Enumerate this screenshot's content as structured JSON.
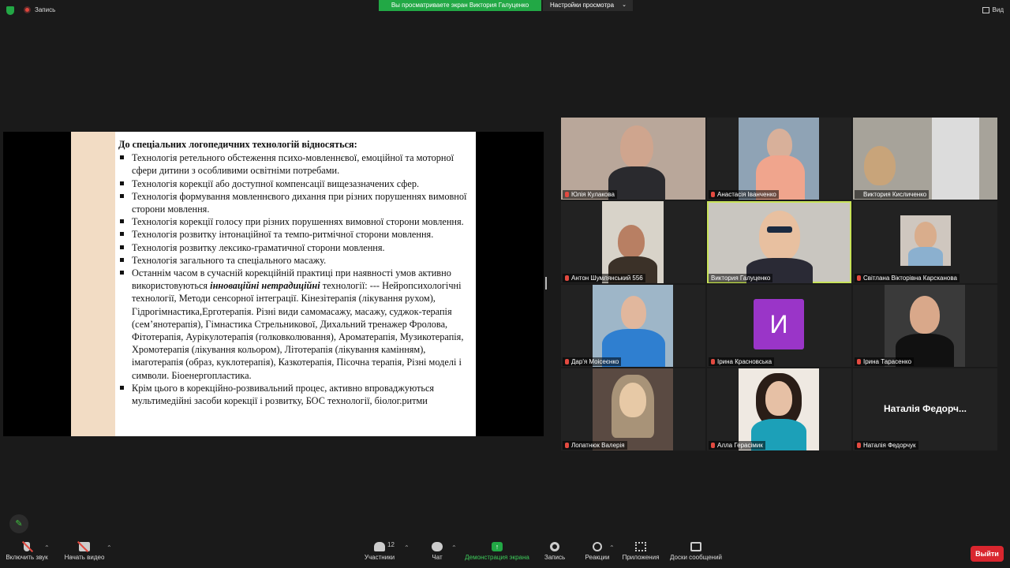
{
  "topbar": {
    "record_label": "Запись",
    "sharing_banner": "Вы просматриваете экран Виктория Галуценко",
    "view_options_label": "Настройки просмотра",
    "view_label": "Вид"
  },
  "slide": {
    "title": "До спеціальних логопедичних  технологій відносяться:",
    "items": [
      "Технологія ретельного обстеження психо-мовленнєвої, емоційної та моторної сфери дитини з особливими освітніми потребами.",
      "Технологія корекції або доступної компенсації вищезазначених сфер.",
      "Технологія формування мовленнєвого дихання при різних порушеннях вимовної сторони мовлення.",
      "Технологія корекції голосу при різних порушеннях  вимовної сторони мовлення.",
      "Технологія розвитку інтонаційної та темпо-ритмічної сторони мовлення.",
      "Технологія розвитку лексико-граматичної сторони мовлення.",
      "Технологія загального та спеціального масажу."
    ],
    "item8_before": "Останнім часом в сучасній корекційній практиці при наявності умов активно використовуються ",
    "item8_em": "інноваційні нетрадиційні",
    "item8_after": "  технології: --- Нейропсихологічні  технології, Методи сенсорної інтеграції. Кінезітерапія (лікування рухом), Гідрогімнастика,Ерготерапія. Різні види самомасажу, масажу, суджок-терапія (сем’янотерапія), Гімнастика Стрельникової, Дихальний тренажер Фролова, Фітотерапія, Аурікулотерапія (голковколювання), Ароматерапія, Музикотерапія, Хромотерапія (лікування кольором), Літотерапія (лікування камінням), імаготерапія (образ, куклотерапія), Казкотерапія, Пісочна терапія, Різні моделі і символи. Біоенергопластика.",
    "item9": "Крім цього в корекційно-розвивальний процес, активно впроваджуються мультимедійні засоби корекції і розвитку, БОС технології, біолог.ритми"
  },
  "participants": [
    {
      "name": "Юлія Кулакова"
    },
    {
      "name": "Анастасія Іванченко"
    },
    {
      "name": "Виктория Кисличенко"
    },
    {
      "name": "Антон Шумлянський 556"
    },
    {
      "name": "Виктория Галуценко"
    },
    {
      "name": "Світлана Вікторівна Карсканова"
    },
    {
      "name": "Дар'я Моісеєнко"
    },
    {
      "name": "Ірина Красновська",
      "avatar_letter": "И"
    },
    {
      "name": "Ірина Тарасенко"
    },
    {
      "name": "Лопатнюк Валерія"
    },
    {
      "name": "Алла Герасімик"
    },
    {
      "name": "Наталія Федорчук",
      "display_name": "Наталія Федорч..."
    }
  ],
  "toolbar": {
    "unmute": "Включить звук",
    "start_video": "Начать видео",
    "participants": "Участники",
    "participants_count": "12",
    "chat": "Чат",
    "share_screen": "Демонстрация экрана",
    "record": "Запись",
    "reactions": "Реакции",
    "apps": "Приложения",
    "whiteboards": "Доски сообщений",
    "leave": "Выйти"
  },
  "colors": {
    "share_green": "#22a845",
    "active_speaker": "#c8e35a",
    "leave_red": "#d9262e",
    "avatar_purple": "#9a35c8"
  }
}
